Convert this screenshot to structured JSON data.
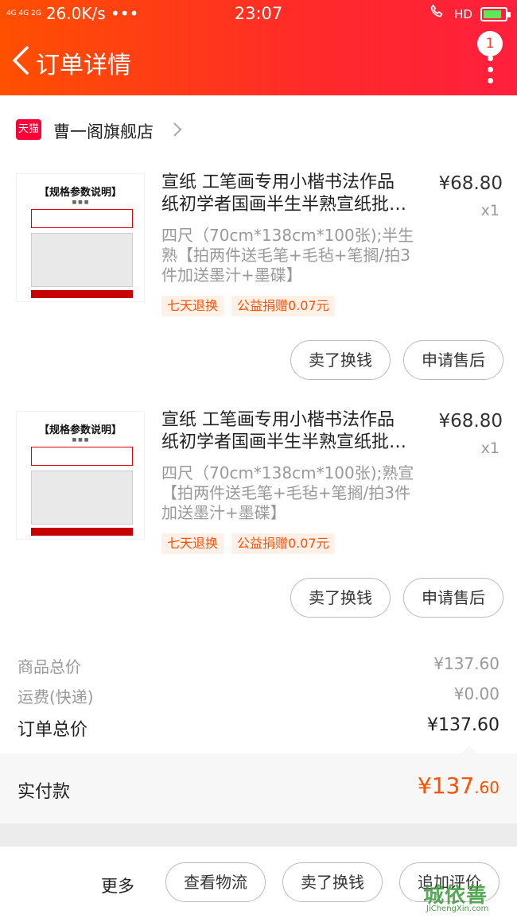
{
  "status_bar": {
    "signal": "4G 4G 2G",
    "net_speed": "26.0K/s •••",
    "time": "23:07",
    "hd": "HD"
  },
  "header": {
    "title": "订单详情",
    "badge_count": "1"
  },
  "shop": {
    "badge": "天猫",
    "name": "曹一阁旗舰店"
  },
  "items": [
    {
      "thumb_title": "【规格参数说明】",
      "title_line1": "宣纸 工笔画专用小楷书法作品",
      "title_line2": "纸初学者国画半生半熟宣纸批…",
      "price": "¥68.80",
      "qty": "x1",
      "spec": "四尺（70cm*138cm*100张);半生熟【拍两件送毛笔+毛毡+笔搁/拍3件加送墨汁+墨碟】",
      "tag1": "七天退换",
      "tag2": "公益捐赠0.07元",
      "btn1": "卖了换钱",
      "btn2": "申请售后"
    },
    {
      "thumb_title": "【规格参数说明】",
      "title_line1": "宣纸 工笔画专用小楷书法作品",
      "title_line2": "纸初学者国画半生半熟宣纸批…",
      "price": "¥68.80",
      "qty": "x1",
      "spec": "四尺（70cm*138cm*100张);熟宣【拍两件送毛笔+毛毡+笔搁/拍3件加送墨汁+墨碟】",
      "tag1": "七天退换",
      "tag2": "公益捐赠0.07元",
      "btn1": "卖了换钱",
      "btn2": "申请售后"
    }
  ],
  "summary": {
    "goods_total_label": "商品总价",
    "goods_total": "¥137.60",
    "shipping_label": "运费(快递)",
    "shipping": "¥0.00",
    "order_total_label": "订单总价",
    "order_total": "¥137.60",
    "paid_label": "实付款",
    "paid_main": "¥137",
    "paid_decimal": ".60"
  },
  "bottom_bar": {
    "more": "更多",
    "logistics": "查看物流",
    "sell": "卖了换钱",
    "review": "追加评价"
  },
  "watermark": {
    "logo": "城依善",
    "url": "JiChengXin.com"
  },
  "colors": {
    "header_start": "#ff5000",
    "header_end": "#ff1f3d",
    "accent": "#ff5000",
    "tmall": "#ff0036"
  }
}
